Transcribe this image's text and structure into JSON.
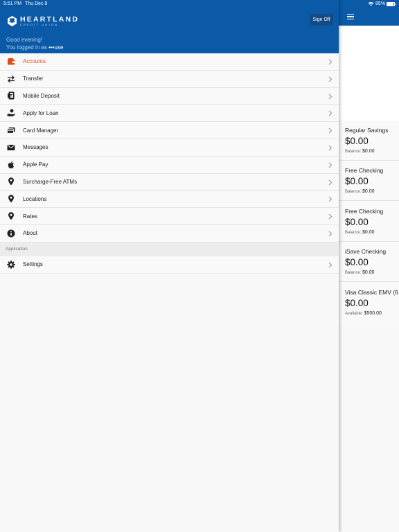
{
  "status_bar": {
    "time": "5:51 PM",
    "date": "Thu Dec 8",
    "battery": "85%",
    "battery_level": 0.85
  },
  "brand": {
    "name": "HEARTLAND",
    "subtitle": "CREDIT UNION",
    "primary_color": "#0a5aa8",
    "accent_color": "#e04e14"
  },
  "header": {
    "sign_off_label": "Sign Off",
    "greeting": "Good evening!",
    "logged_in_prefix": "You logged in as",
    "username": "•••use"
  },
  "menu": {
    "items": [
      {
        "label": "Accounts",
        "icon": "wallet-icon",
        "active": true
      },
      {
        "label": "Transfer",
        "icon": "transfer-arrows-icon"
      },
      {
        "label": "Mobile Deposit",
        "icon": "mobile-deposit-icon"
      },
      {
        "label": "Apply for Loan",
        "icon": "loan-hand-icon"
      },
      {
        "label": "Card Manager",
        "icon": "card-icon"
      },
      {
        "label": "Messages",
        "icon": "envelope-icon"
      },
      {
        "label": "Apple Pay",
        "icon": "apple-icon"
      },
      {
        "label": "Surcharge-Free ATMs",
        "icon": "map-pin-icon"
      },
      {
        "label": "Locations",
        "icon": "map-pin-icon"
      },
      {
        "label": "Rates",
        "icon": "map-pin-icon"
      },
      {
        "label": "About",
        "icon": "info-icon"
      }
    ],
    "section_label": "Application",
    "settings": {
      "label": "Settings",
      "icon": "gear-icon"
    }
  },
  "accounts": [
    {
      "name": "Regular Savings",
      "amount": "$0.00",
      "sub_label": "Balance:",
      "sub_value": "$0.00"
    },
    {
      "name": "Free Checking",
      "amount": "$0.00",
      "sub_label": "Balance:",
      "sub_value": "$0.00"
    },
    {
      "name": "Free Checking",
      "amount": "$0.00",
      "sub_label": "Balance:",
      "sub_value": "$0.00"
    },
    {
      "name": "iSave Checking",
      "amount": "$0.00",
      "sub_label": "Balance:",
      "sub_value": "$0.00"
    },
    {
      "name": "Visa Classic EMV (6",
      "amount": "$0.00",
      "sub_label": "Available:",
      "sub_value": "$500.00"
    }
  ]
}
